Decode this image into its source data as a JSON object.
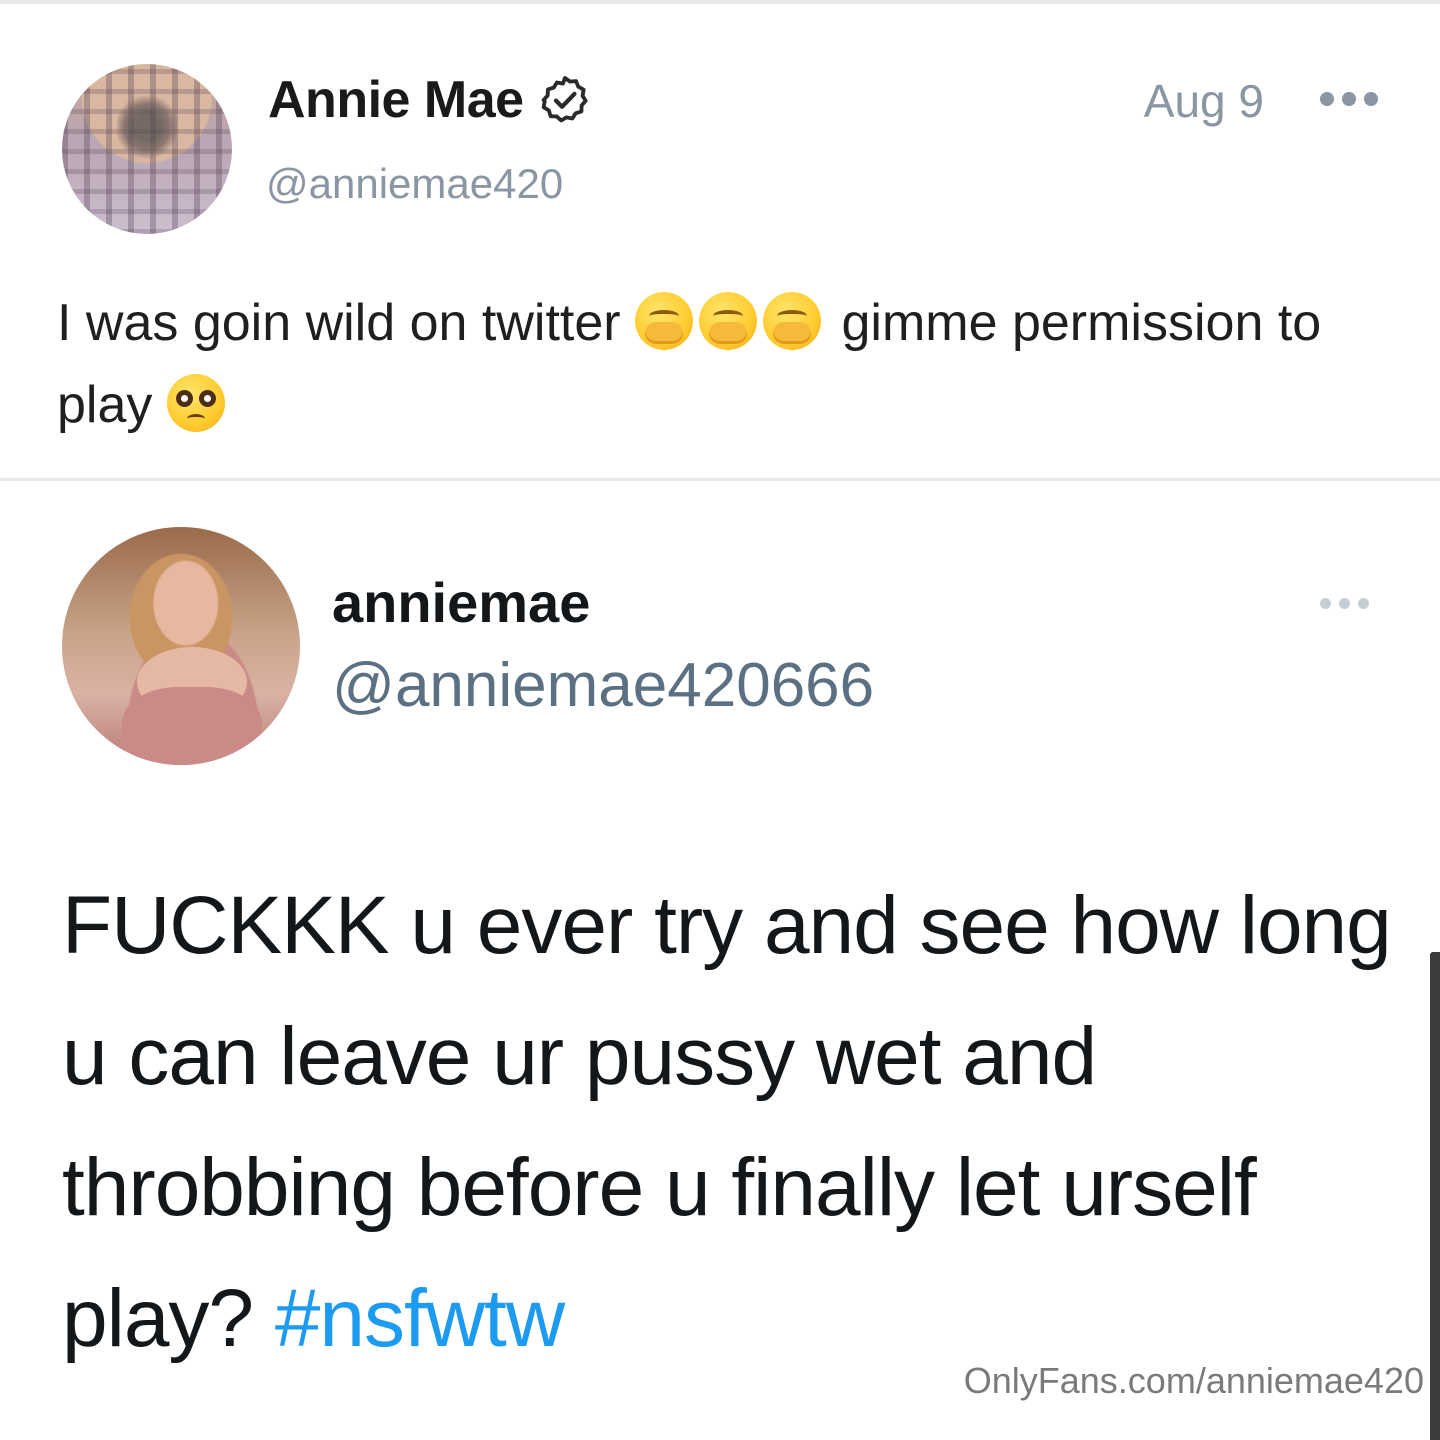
{
  "post": {
    "author_name": "Annie Mae",
    "author_handle": "@anniemae420",
    "date": "Aug 9",
    "caption_part1": "I was goin wild on twitter ",
    "caption_part2": " gimme permission to play ",
    "icons": [
      "verified-badge-icon",
      "face-with-hand-over-mouth-icon",
      "pleading-face-icon",
      "more-options-icon"
    ]
  },
  "tweet": {
    "name": "anniemae",
    "handle": "@anniemae420666",
    "text": "FUCKKK u ever try and see how long u can leave ur pussy wet and throbbing before u finally let urself play? ",
    "hashtag": "#nsfwtw"
  },
  "watermark": "OnlyFans.com/anniemae420",
  "colors": {
    "secondary_text": "#8a96a3",
    "hashtag": "#1d9bf0",
    "tweet_handle": "#5b7083"
  }
}
